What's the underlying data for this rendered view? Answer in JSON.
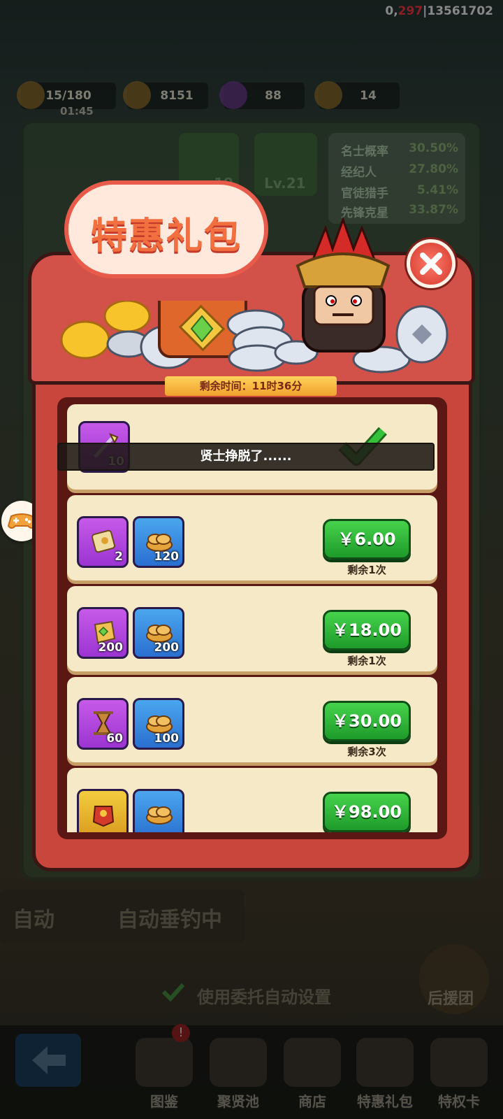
{
  "status_bar": {
    "left": "0,",
    "red": "297",
    "right": "|13561702"
  },
  "hud": {
    "stamina": "15/180",
    "stamina_timer": "01:45",
    "coins": "8151",
    "gems": "88",
    "tickets": "14"
  },
  "background_panel": {
    "count_19": "19",
    "level": "Lv.21",
    "rates": [
      {
        "name": "名士概率",
        "value": "30.50%"
      },
      {
        "name": "经纪人",
        "value": "27.80%"
      },
      {
        "name": "官徒猎手",
        "value": "5.41%"
      },
      {
        "name": "先锋克星",
        "value": "33.87%"
      }
    ]
  },
  "popup": {
    "title": "特惠礼包",
    "timer": "剩余时间：11时36分",
    "toast": "贤士挣脱了......",
    "packs": [
      {
        "items": [
          {
            "count": "10",
            "color": "purple",
            "icon": "spear-icon"
          }
        ],
        "purchased": true
      },
      {
        "items": [
          {
            "count": "2",
            "color": "purple",
            "icon": "scroll-icon"
          },
          {
            "count": "120",
            "color": "blue",
            "icon": "bread-icon"
          }
        ],
        "price": "￥6.00",
        "remain": "剩余1次"
      },
      {
        "items": [
          {
            "count": "200",
            "color": "purple",
            "icon": "gem-token-icon"
          },
          {
            "count": "200",
            "color": "blue",
            "icon": "bread-icon"
          }
        ],
        "price": "￥18.00",
        "remain": "剩余1次"
      },
      {
        "items": [
          {
            "count": "60",
            "color": "purple",
            "icon": "hourglass-icon"
          },
          {
            "count": "100",
            "color": "blue",
            "icon": "bread-icon"
          }
        ],
        "price": "￥30.00",
        "remain": "剩余3次"
      },
      {
        "items": [
          {
            "count": "",
            "color": "gold",
            "icon": "armor-icon"
          },
          {
            "count": "",
            "color": "blue",
            "icon": "bread-icon"
          }
        ],
        "price": "￥98.00",
        "remain": ""
      }
    ]
  },
  "bottom": {
    "auto_label": "自动",
    "auto_fishing": "自动垂钓中",
    "use_delegate": "使用委托自动设置",
    "support_team": "后援团"
  },
  "nav": {
    "items": [
      {
        "label": "图鉴"
      },
      {
        "label": "聚贤池"
      },
      {
        "label": "商店"
      },
      {
        "label": "特惠礼包"
      },
      {
        "label": "特权卡"
      }
    ]
  },
  "colors": {
    "price_button": "#2fb83a",
    "box_red": "#c9463c",
    "title_orange": "#f27040"
  }
}
